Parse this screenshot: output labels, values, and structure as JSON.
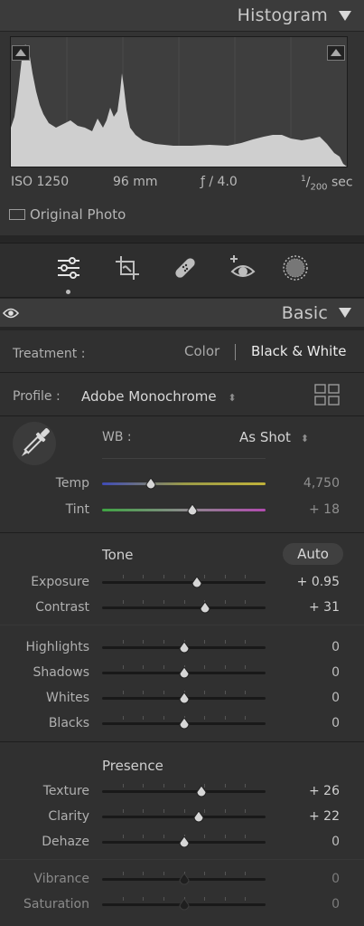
{
  "histogram": {
    "title": "Histogram",
    "iso": "ISO 1250",
    "focal": "96 mm",
    "aperture": "ƒ / 4.0",
    "shutter_num": "1",
    "shutter_den": "200",
    "shutter_unit": "sec",
    "original_photo_label": "Original Photo"
  },
  "tools": [
    "edit-sliders-icon",
    "crop-icon",
    "healing-bandage-icon",
    "red-eye-icon",
    "masking-icon"
  ],
  "basic": {
    "title": "Basic",
    "treatment_label": "Treatment :",
    "treatment_color": "Color",
    "treatment_bw": "Black & White",
    "profile_label": "Profile :",
    "profile_value": "Adobe Monochrome",
    "wb_label": "WB :",
    "wb_value": "As Shot",
    "temp": {
      "label": "Temp",
      "value": "4,750",
      "position": 0.3
    },
    "tint": {
      "label": "Tint",
      "value": "+ 18",
      "position": 0.55
    },
    "tone_label": "Tone",
    "auto_label": "Auto",
    "exposure": {
      "label": "Exposure",
      "value": "+ 0.95",
      "position": 0.58
    },
    "contrast": {
      "label": "Contrast",
      "value": "+ 31",
      "position": 0.63
    },
    "highlights": {
      "label": "Highlights",
      "value": "0",
      "position": 0.5
    },
    "shadows": {
      "label": "Shadows",
      "value": "0",
      "position": 0.5
    },
    "whites": {
      "label": "Whites",
      "value": "0",
      "position": 0.5
    },
    "blacks": {
      "label": "Blacks",
      "value": "0",
      "position": 0.5
    },
    "presence_label": "Presence",
    "texture": {
      "label": "Texture",
      "value": "+ 26",
      "position": 0.61
    },
    "clarity": {
      "label": "Clarity",
      "value": "+ 22",
      "position": 0.59
    },
    "dehaze": {
      "label": "Dehaze",
      "value": "0",
      "position": 0.5
    },
    "vibrance": {
      "label": "Vibrance",
      "value": "0",
      "position": 0.5
    },
    "saturation": {
      "label": "Saturation",
      "value": "0",
      "position": 0.5
    }
  },
  "colors": {
    "panel_bg": "#303030",
    "header_bg": "#3b3b3b",
    "histogram_fill": "#cfcfcf"
  }
}
